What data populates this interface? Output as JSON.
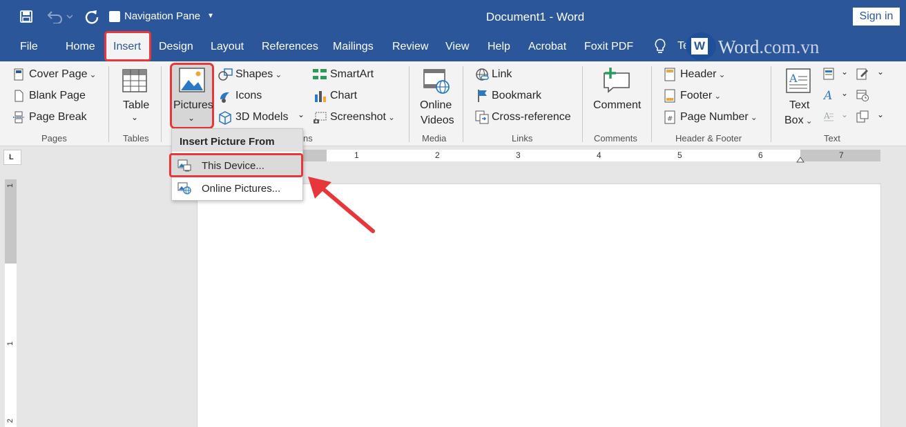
{
  "titlebar": {
    "nav_pane_label": "Navigation Pane",
    "document_title": "Document1  -  Word",
    "sign_in": "Sign in"
  },
  "tabs": [
    {
      "label": "File"
    },
    {
      "label": "Home"
    },
    {
      "label": "Insert"
    },
    {
      "label": "Design"
    },
    {
      "label": "Layout"
    },
    {
      "label": "References"
    },
    {
      "label": "Mailings"
    },
    {
      "label": "Review"
    },
    {
      "label": "View"
    },
    {
      "label": "Help"
    },
    {
      "label": "Acrobat"
    },
    {
      "label": "Foxit PDF"
    }
  ],
  "tell_me": "Te",
  "watermark": {
    "prefix": "Word",
    "suffix": ".com.vn"
  },
  "ribbon": {
    "pages": {
      "cover_page": "Cover Page",
      "blank_page": "Blank Page",
      "page_break": "Page Break",
      "group": "Pages"
    },
    "tables": {
      "table": "Table",
      "group": "Tables"
    },
    "illustrations": {
      "pictures": "Pictures",
      "shapes": "Shapes",
      "icons": "Icons",
      "models": "3D Models",
      "smartart": "SmartArt",
      "chart": "Chart",
      "screenshot": "Screenshot",
      "group_tail": "ns"
    },
    "media": {
      "online_videos_1": "Online",
      "online_videos_2": "Videos",
      "group": "Media"
    },
    "links": {
      "link": "Link",
      "bookmark": "Bookmark",
      "cross_reference": "Cross-reference",
      "group": "Links"
    },
    "comments": {
      "comment": "Comment",
      "group": "Comments"
    },
    "header_footer": {
      "header": "Header",
      "footer": "Footer",
      "page_number": "Page Number",
      "group": "Header & Footer"
    },
    "text": {
      "text_box_1": "Text",
      "text_box_2": "Box",
      "group": "Text"
    }
  },
  "dropdown": {
    "header": "Insert Picture From",
    "this_device": "This Device...",
    "online_pictures": "Online Pictures..."
  },
  "ruler": {
    "h": [
      "1",
      "2",
      "3",
      "4",
      "5",
      "6",
      "7"
    ],
    "v": [
      "1",
      "1",
      "2"
    ],
    "tab_selector": "L"
  },
  "colors": {
    "title_blue": "#2b579a",
    "highlight_red": "#e8373a"
  }
}
